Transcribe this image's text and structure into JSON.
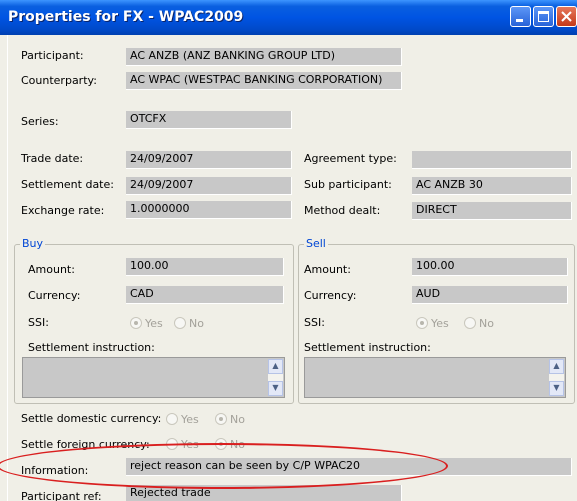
{
  "window": {
    "title": "Properties for FX - WPAC2009"
  },
  "general": {
    "participant_label": "Participant:",
    "participant_value": "AC ANZB  (ANZ BANKING GROUP LTD)",
    "counterparty_label": "Counterparty:",
    "counterparty_value": "AC WPAC  (WESTPAC BANKING CORPORATION)",
    "series_label": "Series:",
    "series_value": "OTCFX",
    "trade_date_label": "Trade date:",
    "trade_date_value": "24/09/2007",
    "agreement_type_label": "Agreement type:",
    "agreement_type_value": "",
    "settlement_date_label": "Settlement date:",
    "settlement_date_value": "24/09/2007",
    "sub_participant_label": "Sub participant:",
    "sub_participant_value": "AC ANZB 30",
    "exchange_rate_label": "Exchange rate:",
    "exchange_rate_value": "1.0000000",
    "method_dealt_label": "Method dealt:",
    "method_dealt_value": "DIRECT"
  },
  "buy": {
    "legend": "Buy",
    "amount_label": "Amount:",
    "amount_value": "100.00",
    "currency_label": "Currency:",
    "currency_value": "CAD",
    "ssi_label": "SSI:",
    "ssi_yes": "Yes",
    "ssi_no": "No",
    "ssi_selected": "Yes",
    "settlement_instruction_label": "Settlement instruction:"
  },
  "sell": {
    "legend": "Sell",
    "amount_label": "Amount:",
    "amount_value": "100.00",
    "currency_label": "Currency:",
    "currency_value": "AUD",
    "ssi_label": "SSI:",
    "ssi_yes": "Yes",
    "ssi_no": "No",
    "ssi_selected": "Yes",
    "settlement_instruction_label": "Settlement instruction:"
  },
  "settle": {
    "domestic_label": "Settle domestic currency:",
    "domestic_yes": "Yes",
    "domestic_no": "No",
    "domestic_selected": "No",
    "foreign_label": "Settle foreign currency:",
    "foreign_yes": "Yes",
    "foreign_no": "No",
    "foreign_selected": "No"
  },
  "information": {
    "label": "Information:",
    "value": "reject reason can be seen by C/P WPAC20"
  },
  "participant_ref": {
    "label": "Participant ref:",
    "value": "Rejected trade"
  },
  "colors": {
    "titlebar": "#0054e3",
    "window_bg": "#f0efe7",
    "field_bg": "#c8c8c8",
    "legend_text": "#0046d5",
    "highlight_ellipse": "#d91f1f"
  },
  "icons": [
    "minimize-icon",
    "maximize-icon",
    "close-icon",
    "scroll-up-icon",
    "scroll-down-icon"
  ]
}
